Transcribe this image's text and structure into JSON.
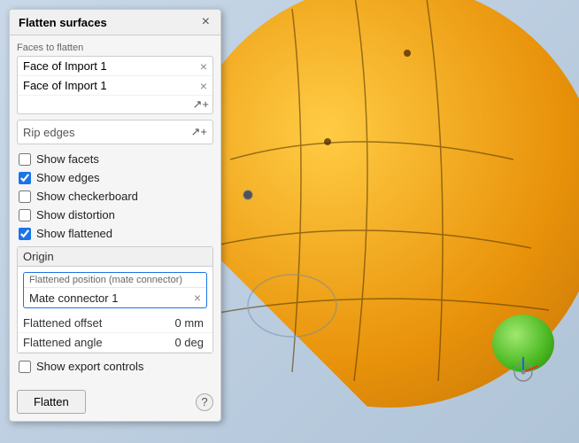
{
  "panel": {
    "title": "Flatten surfaces",
    "close_label": "×",
    "faces_section": {
      "label": "Faces to flatten",
      "faces": [
        {
          "text": "Face of Import 1"
        },
        {
          "text": "Face of Import 1"
        }
      ]
    },
    "rip_edges": {
      "label": "Rip edges"
    },
    "checkboxes": [
      {
        "id": "show-facets",
        "label": "Show facets",
        "checked": false
      },
      {
        "id": "show-edges",
        "label": "Show edges",
        "checked": true
      },
      {
        "id": "show-checkerboard",
        "label": "Show checkerboard",
        "checked": false
      },
      {
        "id": "show-distortion",
        "label": "Show distortion",
        "checked": false
      },
      {
        "id": "show-flattened",
        "label": "Show flattened",
        "checked": true
      }
    ],
    "origin": {
      "label": "Origin",
      "flattened_position": {
        "header": "Flattened position (mate connector)",
        "value": "Mate connector 1"
      }
    },
    "properties": [
      {
        "label": "Flattened offset",
        "value": "0 mm"
      },
      {
        "label": "Flattened angle",
        "value": "0 deg"
      }
    ],
    "show_export_controls": {
      "label": "Show export controls",
      "checked": false
    },
    "flatten_button": "Flatten",
    "help_icon": "?"
  }
}
